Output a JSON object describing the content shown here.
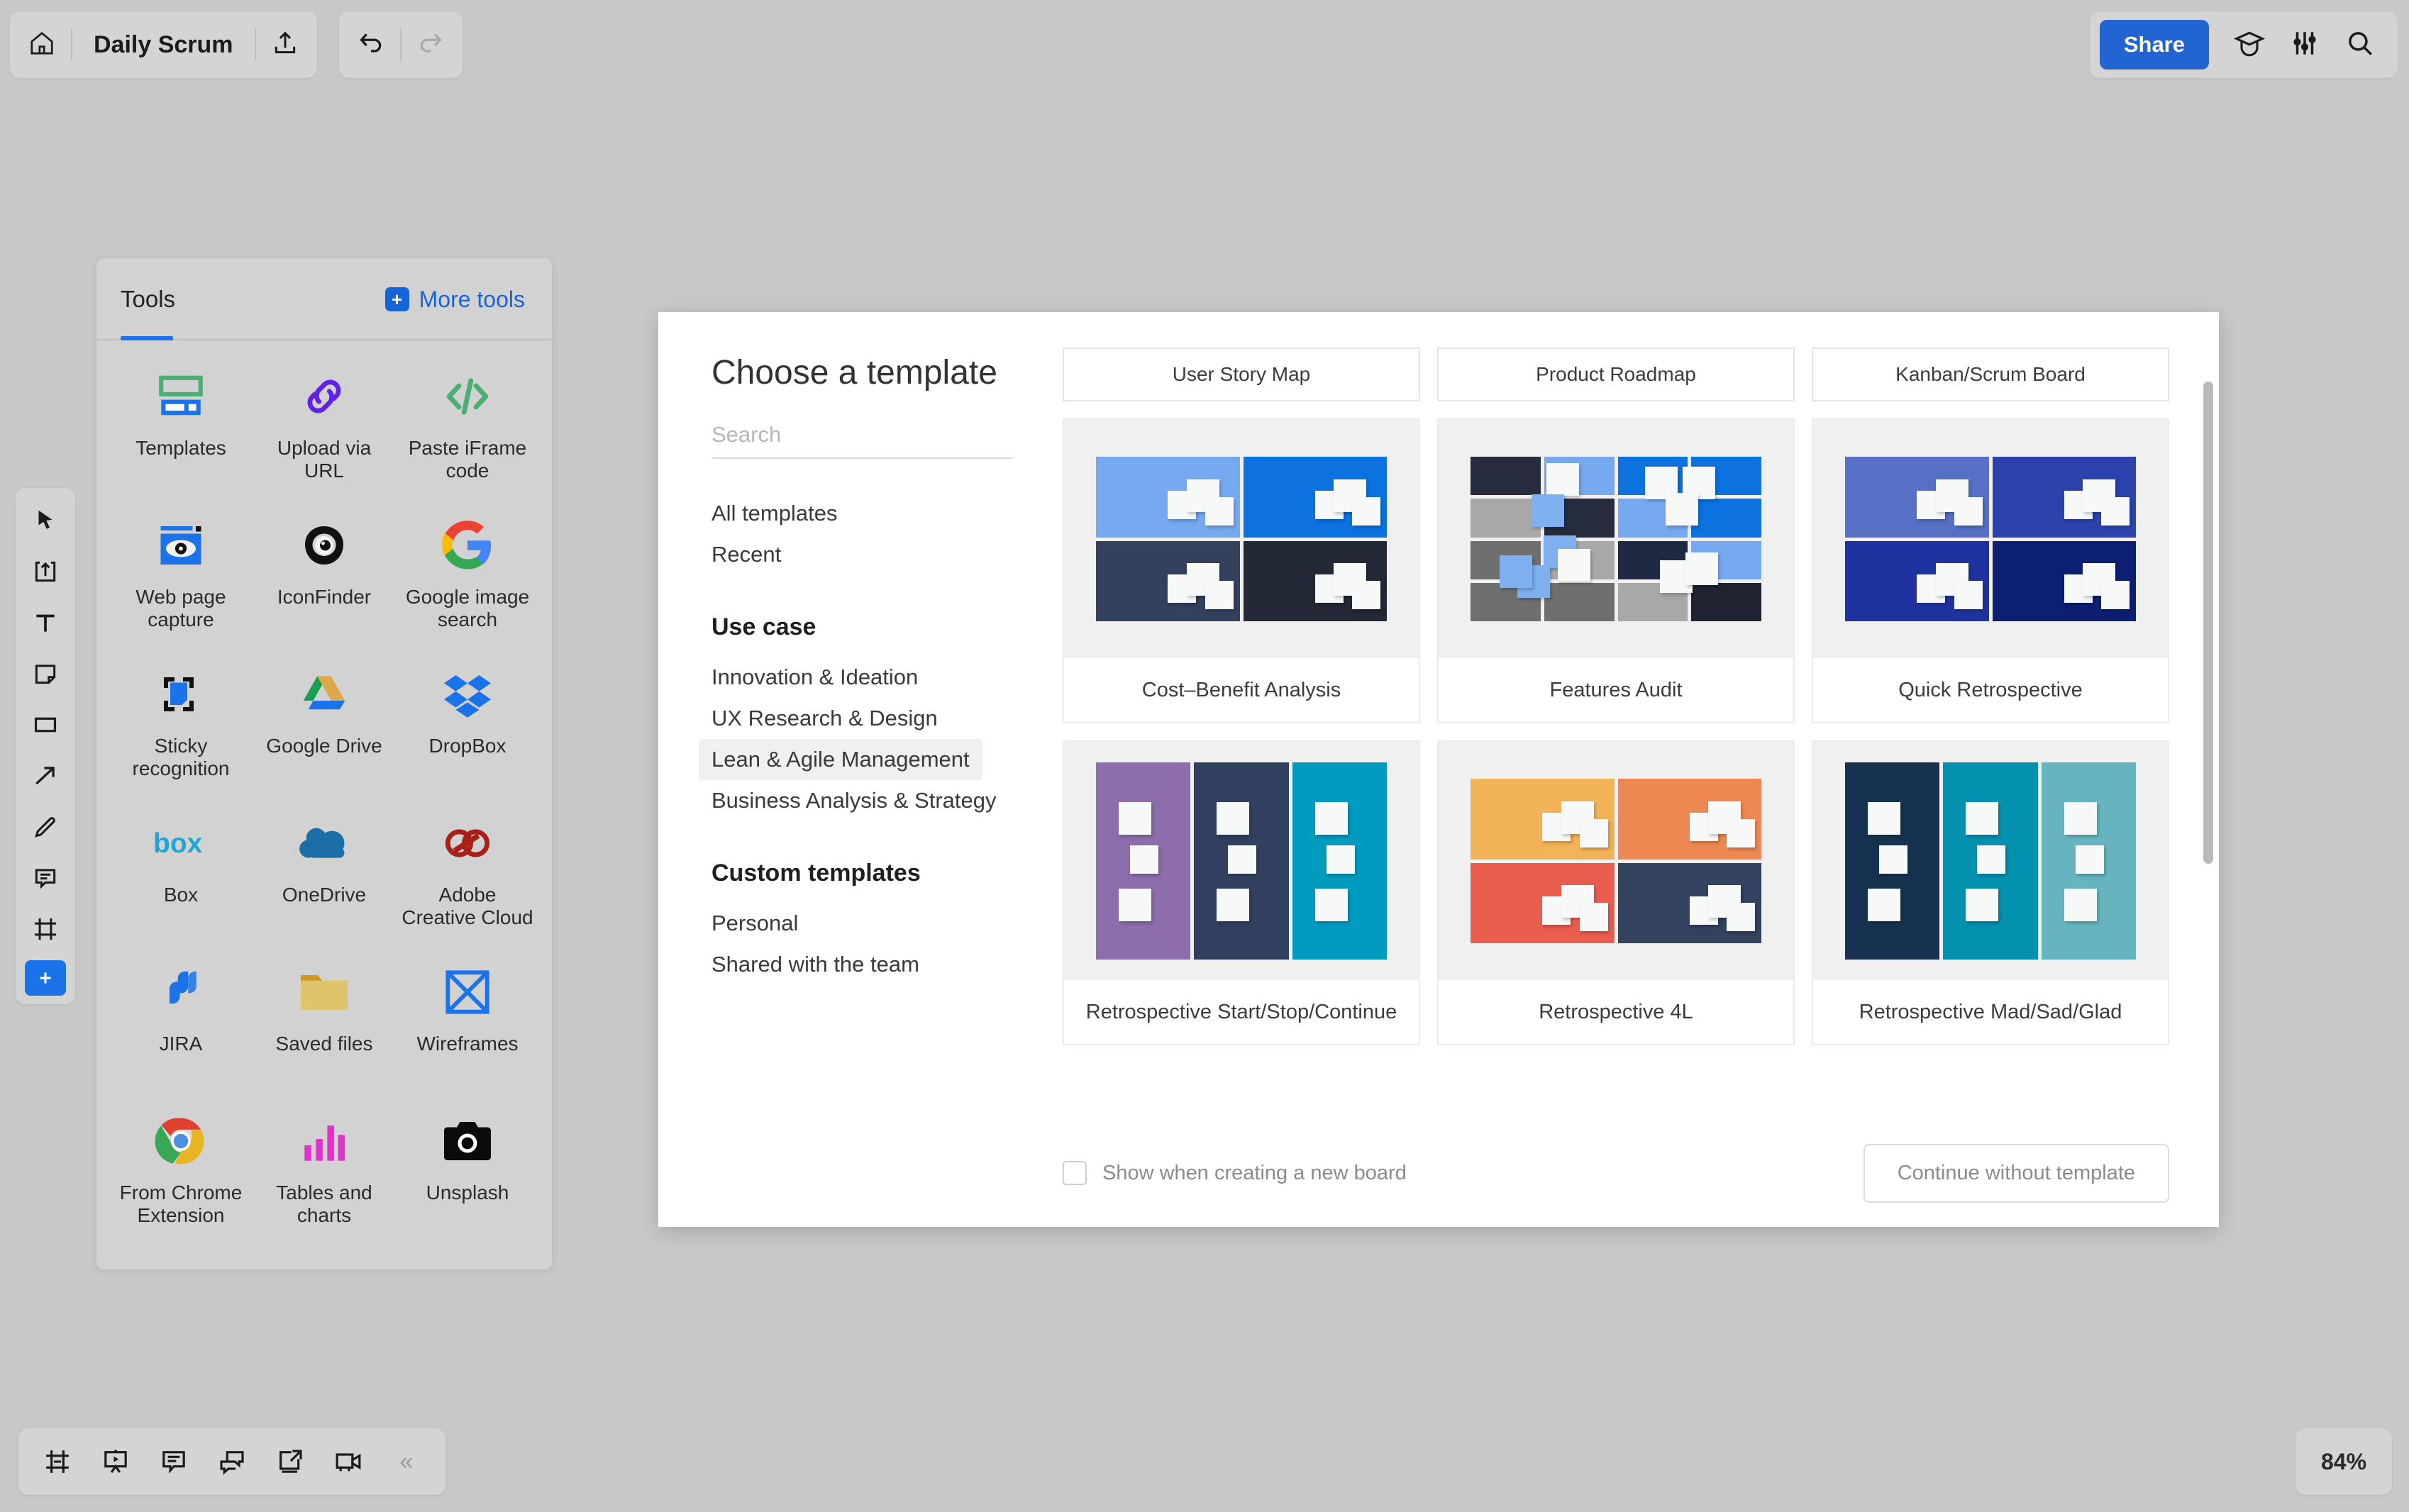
{
  "topbar": {
    "home_icon": "home-icon",
    "board_title": "Daily Scrum",
    "export_icon": "upload-export-icon",
    "undo_icon": "undo-icon",
    "redo_icon": "redo-icon",
    "share_label": "Share",
    "learning_icon": "graduation-cap-icon",
    "settings_icon": "sliders-icon",
    "search_icon": "search-icon",
    "accent_color": "#2264d1"
  },
  "left_toolbar": {
    "items": [
      {
        "name": "cursor-select-tool"
      },
      {
        "name": "upload-tool"
      },
      {
        "name": "text-tool"
      },
      {
        "name": "sticky-note-tool"
      },
      {
        "name": "shape-rectangle-tool"
      },
      {
        "name": "arrow-connector-tool"
      },
      {
        "name": "pen-draw-tool"
      },
      {
        "name": "comment-tool"
      },
      {
        "name": "frame-tool"
      }
    ],
    "add_button": "add-more-tools-button"
  },
  "tools_panel": {
    "tab_label": "Tools",
    "more_tools_label": "More tools",
    "more_tools_plus": "plus-icon",
    "items": [
      {
        "label": "Templates",
        "icon": "templates-icon"
      },
      {
        "label": "Upload via URL",
        "icon": "link-chain-icon"
      },
      {
        "label": "Paste iFrame code",
        "icon": "code-brackets-icon"
      },
      {
        "label": "Web page capture",
        "icon": "webpage-eye-icon"
      },
      {
        "label": "IconFinder",
        "icon": "iconfinder-icon"
      },
      {
        "label": "Google image search",
        "icon": "google-g-icon"
      },
      {
        "label": "Sticky recognition",
        "icon": "sticky-recognition-icon"
      },
      {
        "label": "Google Drive",
        "icon": "google-drive-icon"
      },
      {
        "label": "DropBox",
        "icon": "dropbox-icon"
      },
      {
        "label": "Box",
        "icon": "box-logo-icon"
      },
      {
        "label": "OneDrive",
        "icon": "onedrive-cloud-icon"
      },
      {
        "label": "Adobe Creative Cloud",
        "icon": "adobe-creative-cloud-icon"
      },
      {
        "label": "JIRA",
        "icon": "jira-icon"
      },
      {
        "label": "Saved files",
        "icon": "folder-icon"
      },
      {
        "label": "Wireframes",
        "icon": "wireframes-icon"
      },
      {
        "label": "From Chrome Extension",
        "icon": "chrome-icon"
      },
      {
        "label": "Tables and charts",
        "icon": "bar-chart-icon"
      },
      {
        "label": "Unsplash",
        "icon": "camera-icon"
      }
    ]
  },
  "dialog": {
    "title": "Choose a template",
    "search_placeholder": "Search",
    "search_value": "",
    "nav": [
      {
        "label": "All templates",
        "active": false
      },
      {
        "label": "Recent",
        "active": false
      }
    ],
    "use_case_title": "Use case",
    "use_case": [
      {
        "label": "Innovation & Ideation",
        "active": false
      },
      {
        "label": "UX Research & Design",
        "active": false
      },
      {
        "label": "Lean & Agile Management",
        "active": true
      },
      {
        "label": "Business Analysis & Strategy",
        "active": false
      }
    ],
    "custom_title": "Custom templates",
    "custom": [
      {
        "label": "Personal",
        "active": false
      },
      {
        "label": "Shared with the team",
        "active": false
      }
    ],
    "partial_row": [
      {
        "label": "User Story Map"
      },
      {
        "label": "Product Roadmap"
      },
      {
        "label": "Kanban/Scrum Board"
      }
    ],
    "cards": [
      {
        "label": "Cost–Benefit Analysis",
        "layout": "quad",
        "colors": [
          "#76a9f0",
          "#0b72e0",
          "#33415c",
          "#222836"
        ]
      },
      {
        "label": "Features Audit",
        "layout": "grid4",
        "colors": [
          "#262c3d",
          "#76a9f0",
          "#0b72e0",
          "#0b72e0",
          "#a8a8a8",
          "#262c3d",
          "#76a9f0",
          "#0b72e0",
          "#6f6f6f",
          "#a8a8a8",
          "#1e2a44",
          "#76a9f0",
          "#6f6f6f",
          "#6f6f6f",
          "#a8a8a8",
          "#1e2231"
        ]
      },
      {
        "label": "Quick Retrospective",
        "layout": "quad",
        "colors": [
          "#5570c4",
          "#2c43ad",
          "#1f33a0",
          "#0d1f72"
        ]
      },
      {
        "label": "Retrospective Start/Stop/Continue",
        "layout": "cols3",
        "colors": [
          "#8c6eac",
          "#31405f",
          "#019bc0"
        ]
      },
      {
        "label": "Retrospective 4L",
        "layout": "quad",
        "colors": [
          "#f2b257",
          "#ed8852",
          "#e95d4f",
          "#32425f"
        ]
      },
      {
        "label": "Retrospective Mad/Sad/Glad",
        "layout": "cols3",
        "colors": [
          "#173250",
          "#0490af",
          "#66b4bf"
        ]
      }
    ],
    "show_on_new_board_label": "Show when creating a new board",
    "show_on_new_board_checked": false,
    "continue_label": "Continue without template"
  },
  "bottombar": {
    "items": [
      {
        "name": "frames-panel-icon"
      },
      {
        "name": "presentation-mode-icon"
      },
      {
        "name": "comments-panel-icon"
      },
      {
        "name": "chat-icon"
      },
      {
        "name": "screen-share-icon"
      },
      {
        "name": "video-call-icon"
      }
    ],
    "collapse_label": "«"
  },
  "zoom": {
    "level": "84%"
  }
}
